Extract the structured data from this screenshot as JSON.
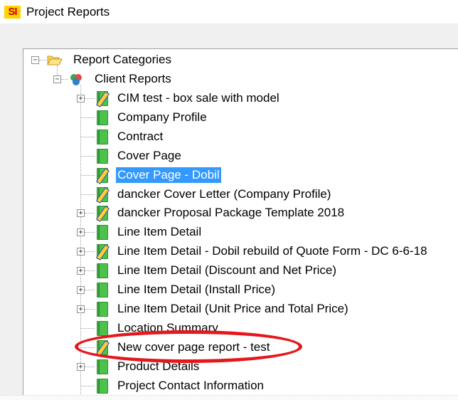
{
  "window": {
    "logo_text": "SI",
    "title": "Project Reports"
  },
  "colors": {
    "selection": "#3399ff",
    "annotation_ellipse": "#e4181c",
    "report_icon": "#4cc24c"
  },
  "tree": {
    "root": {
      "label": "Report Categories",
      "icon": "folder-open-icon",
      "expanded": true
    },
    "category": {
      "label": "Client Reports",
      "icon": "client-reports-icon",
      "expanded": true
    },
    "items": [
      {
        "label": "CIM test - box sale with model",
        "icon": "report-edited-icon",
        "expander": "+",
        "selected": false
      },
      {
        "label": "Company Profile",
        "icon": "report-icon",
        "expander": "",
        "selected": false
      },
      {
        "label": "Contract",
        "icon": "report-icon",
        "expander": "",
        "selected": false
      },
      {
        "label": "Cover Page",
        "icon": "report-icon",
        "expander": "",
        "selected": false
      },
      {
        "label": "Cover Page - Dobil",
        "icon": "report-edited-icon",
        "expander": "",
        "selected": true
      },
      {
        "label": "dancker Cover Letter (Company Profile)",
        "icon": "report-edited-icon",
        "expander": "",
        "selected": false
      },
      {
        "label": "dancker Proposal Package Template 2018",
        "icon": "report-edited-icon",
        "expander": "+",
        "selected": false
      },
      {
        "label": "Line Item Detail",
        "icon": "report-icon",
        "expander": "+",
        "selected": false
      },
      {
        "label": "Line Item Detail - Dobil rebuild of Quote Form - DC 6-6-18",
        "icon": "report-edited-icon",
        "expander": "+",
        "selected": false
      },
      {
        "label": "Line Item Detail (Discount and Net Price)",
        "icon": "report-icon",
        "expander": "+",
        "selected": false
      },
      {
        "label": "Line Item Detail (Install Price)",
        "icon": "report-icon",
        "expander": "+",
        "selected": false
      },
      {
        "label": "Line Item Detail (Unit Price and Total Price)",
        "icon": "report-icon",
        "expander": "+",
        "selected": false
      },
      {
        "label": "Location Summary",
        "icon": "report-icon",
        "expander": "",
        "selected": false
      },
      {
        "label": "New cover page report - test",
        "icon": "report-edited-icon",
        "expander": "",
        "selected": false
      },
      {
        "label": "Product Details",
        "icon": "report-icon",
        "expander": "+",
        "selected": false
      },
      {
        "label": "Project Contact Information",
        "icon": "report-icon",
        "expander": "",
        "selected": false
      }
    ]
  }
}
